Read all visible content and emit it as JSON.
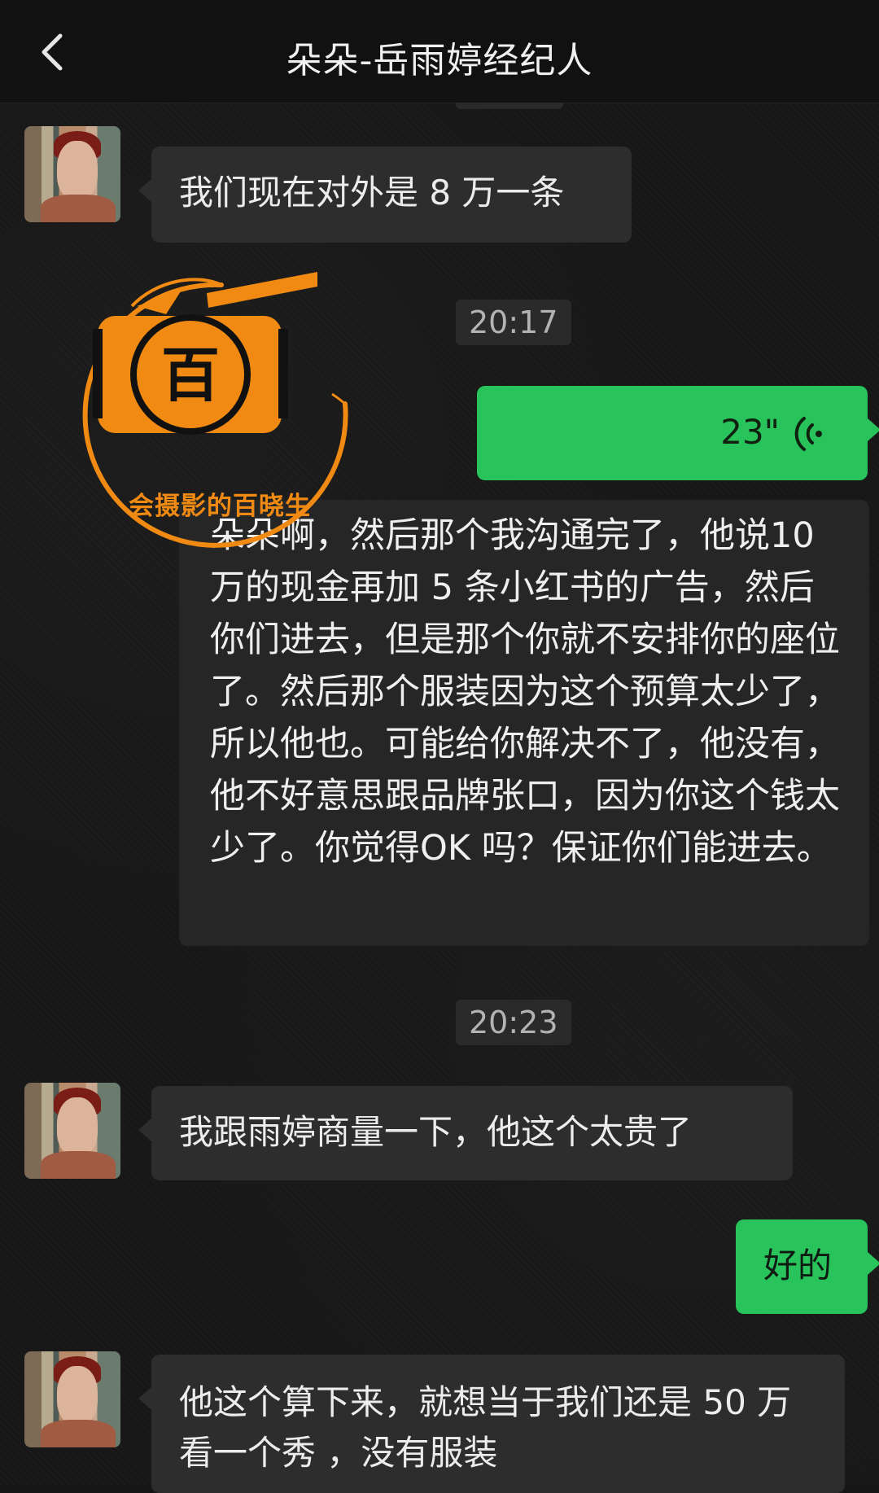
{
  "header": {
    "title": "朵朵-岳雨婷经纪人"
  },
  "messages": [
    {
      "type": "received",
      "text": "我们现在对外是 8 万一条"
    },
    {
      "type": "timestamp",
      "text": "20:17"
    },
    {
      "type": "sent_voice",
      "duration": "23\""
    },
    {
      "type": "voice_transcript",
      "text": "朵朵啊，然后那个我沟通完了，他说10万的现金再加 5 条小红书的广告，然后你们进去，但是那个你就不安排你的座位了。然后那个服装因为这个预算太少了，所以他也。可能给你解决不了，他没有，他不好意思跟品牌张口，因为你这个钱太少了。你觉得OK 吗？保证你们能进去。"
    },
    {
      "type": "timestamp",
      "text": "20:23"
    },
    {
      "type": "received",
      "text": "我跟雨婷商量一下，他这个太贵了"
    },
    {
      "type": "sent",
      "text": "好的"
    },
    {
      "type": "received",
      "text": "他这个算下来，就想当于我们还是 50 万看一个秀 ，没有服装"
    }
  ],
  "watermark": {
    "glyph": "百",
    "caption": "会摄影的百晓生"
  },
  "colors": {
    "sent_bubble": "#28c35b",
    "received_bubble": "#2d2d2d",
    "background": "#171717",
    "watermark_orange": "#f08a12"
  }
}
